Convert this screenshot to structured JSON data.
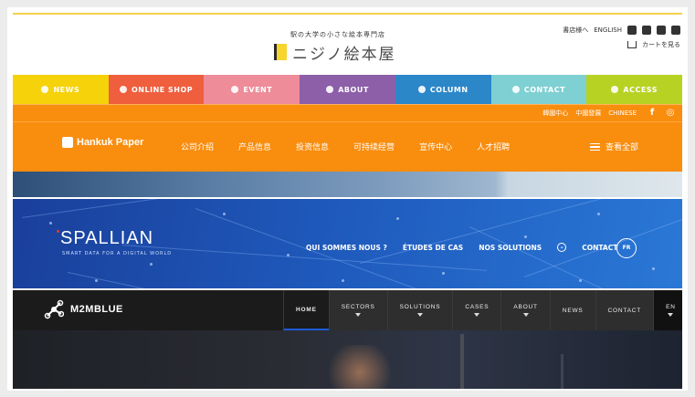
{
  "site1": {
    "logo_sub": "駅の大学の小さな絵本専門店",
    "logo_main": "ニジノ絵本屋",
    "util_links": [
      "書店様へ",
      "ENGLISH"
    ],
    "cart_label": "カートを見る",
    "nav": [
      {
        "label": "NEWS",
        "color": "#f5d20a",
        "icon": "star-icon"
      },
      {
        "label": "ONLINE SHOP",
        "color": "#ef5e3d",
        "icon": "shop-icon"
      },
      {
        "label": "EVENT",
        "color": "#ee8c99",
        "icon": "flag-icon"
      },
      {
        "label": "ABOUT",
        "color": "#8c5fa8",
        "icon": "wifi-icon"
      },
      {
        "label": "COLUMN",
        "color": "#2c87c9",
        "icon": "note-icon"
      },
      {
        "label": "CONTACT",
        "color": "#7fd0d3",
        "icon": "mail-icon"
      },
      {
        "label": "ACCESS",
        "color": "#b8d224",
        "icon": "pin-icon"
      }
    ]
  },
  "site2": {
    "top_links": [
      "韓國中心",
      "中國發展",
      "CHINESE"
    ],
    "logo": "Hankuk Paper",
    "menu": [
      "公司介绍",
      "产品信息",
      "投资信息",
      "可持续经营",
      "宣传中心",
      "人才招聘"
    ],
    "view_all": "查看全部"
  },
  "site3": {
    "logo": "SPALLIAN",
    "tagline": "SMART DATA FOR A DIGITAL WORLD",
    "menu": [
      "QUI SOMMES NOUS ?",
      "ÉTUDES DE CAS",
      "NOS SOLUTIONS",
      "CONTACT"
    ],
    "lang": "FR"
  },
  "site4": {
    "logo": "M2MBLUE",
    "menu": [
      {
        "label": "HOME",
        "caret": false
      },
      {
        "label": "SECTORS",
        "caret": true
      },
      {
        "label": "SOLUTIONS",
        "caret": true
      },
      {
        "label": "CASES",
        "caret": true
      },
      {
        "label": "ABOUT",
        "caret": true
      },
      {
        "label": "NEWS",
        "caret": false
      },
      {
        "label": "CONTACT",
        "caret": false
      }
    ],
    "lang": "EN"
  }
}
